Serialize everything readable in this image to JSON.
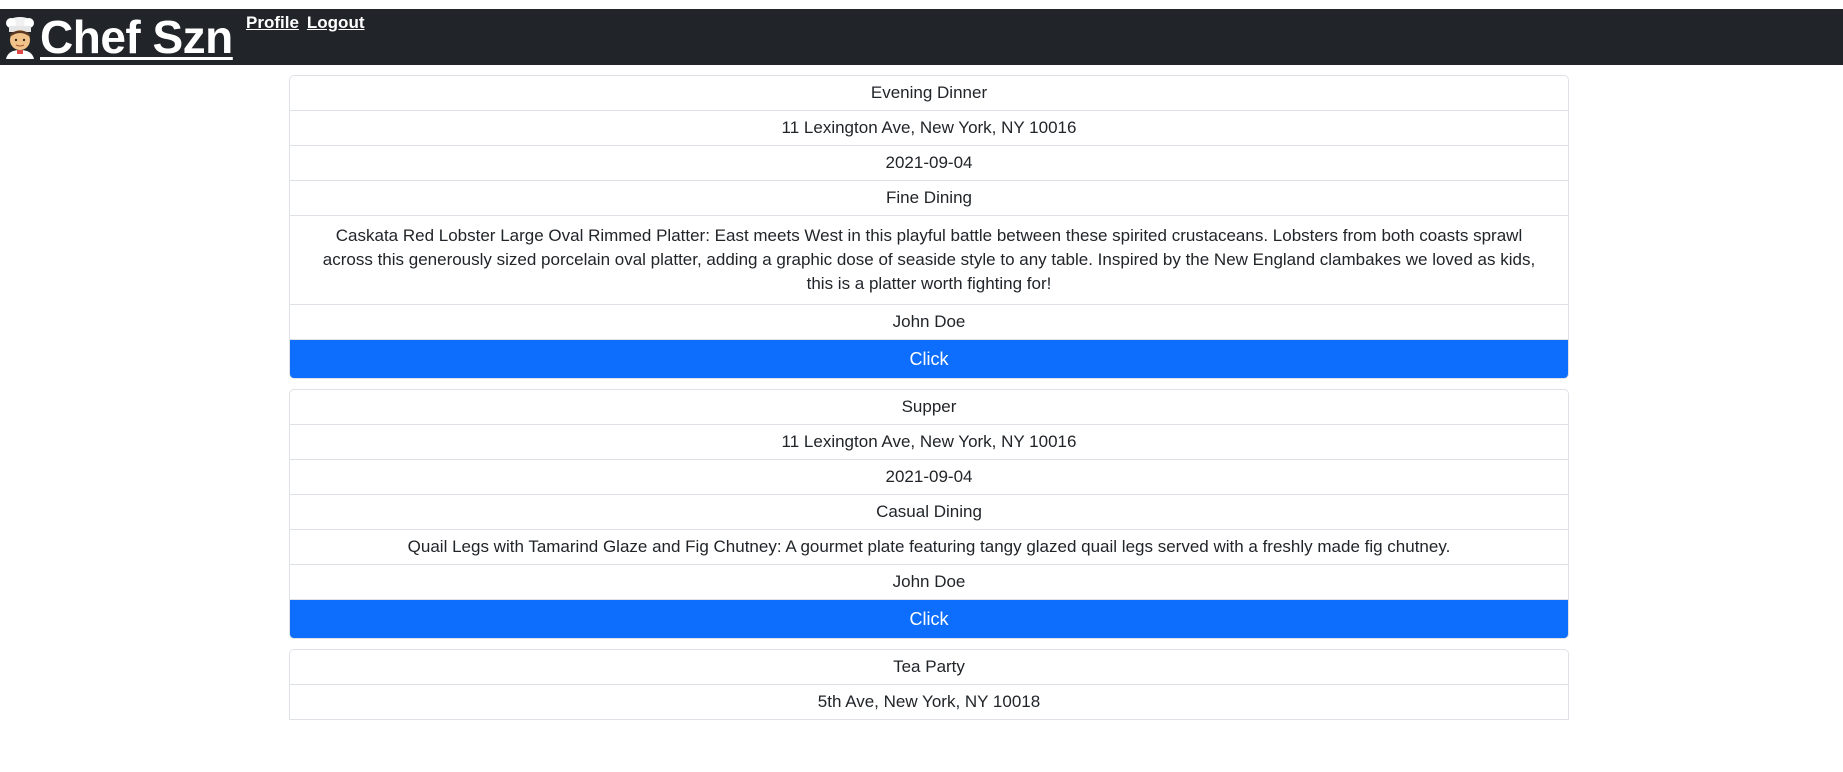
{
  "navbar": {
    "brand": "Chef Szn",
    "brand_icon": "chef-emoji-icon",
    "links": [
      "Profile",
      "Logout"
    ]
  },
  "events": [
    {
      "title": "Evening Dinner",
      "address": "11 Lexington Ave, New York, NY 10016",
      "date": "2021-09-04",
      "category": "Fine Dining",
      "description": "Caskata Red Lobster Large Oval Rimmed Platter: East meets West in this playful battle between these spirited crustaceans. Lobsters from both coasts sprawl across this generously sized porcelain oval platter, adding a graphic dose of seaside style to any table. Inspired by the New England clambakes we loved as kids, this is a platter worth fighting for!",
      "host": "John Doe",
      "button": "Click"
    },
    {
      "title": "Supper",
      "address": "11 Lexington Ave, New York, NY 10016",
      "date": "2021-09-04",
      "category": "Casual Dining",
      "description": "Quail Legs with Tamarind Glaze and Fig Chutney: A gourmet plate featuring tangy glazed quail legs served with a freshly made fig chutney.",
      "host": "John Doe",
      "button": "Click"
    },
    {
      "title": "Tea Party",
      "address": "5th Ave, New York, NY 10018"
    }
  ],
  "colors": {
    "navbar_bg": "#212529",
    "button_bg": "#0d6efd",
    "border": "#dee2e6"
  }
}
